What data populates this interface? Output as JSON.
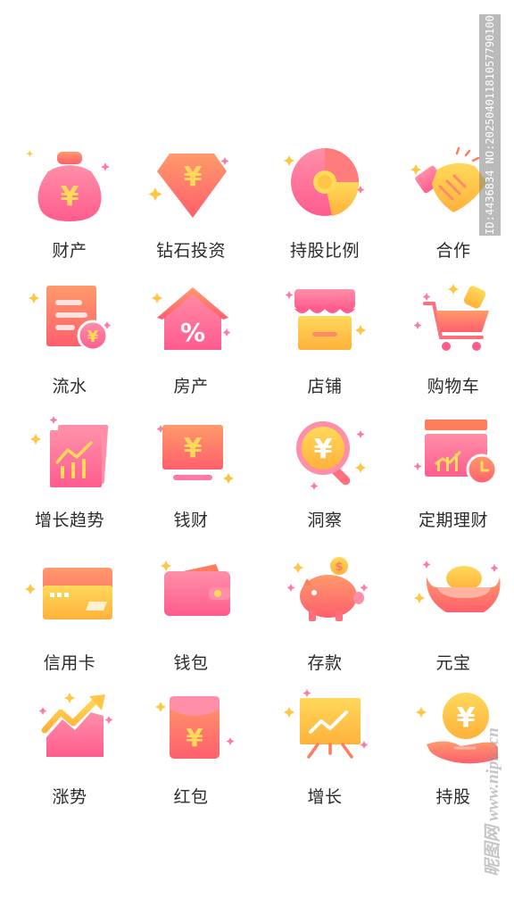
{
  "icons": [
    {
      "label": "财产",
      "icon": "money-bag-icon"
    },
    {
      "label": "钻石投资",
      "icon": "diamond-yuan-icon"
    },
    {
      "label": "持股比例",
      "icon": "donut-chart-icon"
    },
    {
      "label": "合作",
      "icon": "handshake-icon"
    },
    {
      "label": "流水",
      "icon": "receipt-icon"
    },
    {
      "label": "房产",
      "icon": "house-percent-icon"
    },
    {
      "label": "店铺",
      "icon": "shop-icon"
    },
    {
      "label": "购物车",
      "icon": "shopping-cart-icon"
    },
    {
      "label": "增长趋势",
      "icon": "growth-chart-icon"
    },
    {
      "label": "钱财",
      "icon": "monitor-yuan-icon"
    },
    {
      "label": "洞察",
      "icon": "magnifier-yuan-icon"
    },
    {
      "label": "定期理财",
      "icon": "card-clock-icon"
    },
    {
      "label": "信用卡",
      "icon": "credit-card-icon"
    },
    {
      "label": "钱包",
      "icon": "wallet-icon"
    },
    {
      "label": "存款",
      "icon": "piggy-bank-icon"
    },
    {
      "label": "元宝",
      "icon": "gold-ingot-icon"
    },
    {
      "label": "涨势",
      "icon": "rising-trend-icon"
    },
    {
      "label": "红包",
      "icon": "red-envelope-icon"
    },
    {
      "label": "增长",
      "icon": "presentation-board-icon"
    },
    {
      "label": "持股",
      "icon": "hand-coin-icon"
    }
  ],
  "colors": {
    "pink": "#ff6f9b",
    "coral": "#ff7c5c",
    "yellow": "#ffc646",
    "light_pink": "#ffb3c7"
  },
  "watermark": {
    "id_text": "ID:4436834 NO:20250401181057790100",
    "site_text": "昵图网 www.nipic.cn"
  }
}
